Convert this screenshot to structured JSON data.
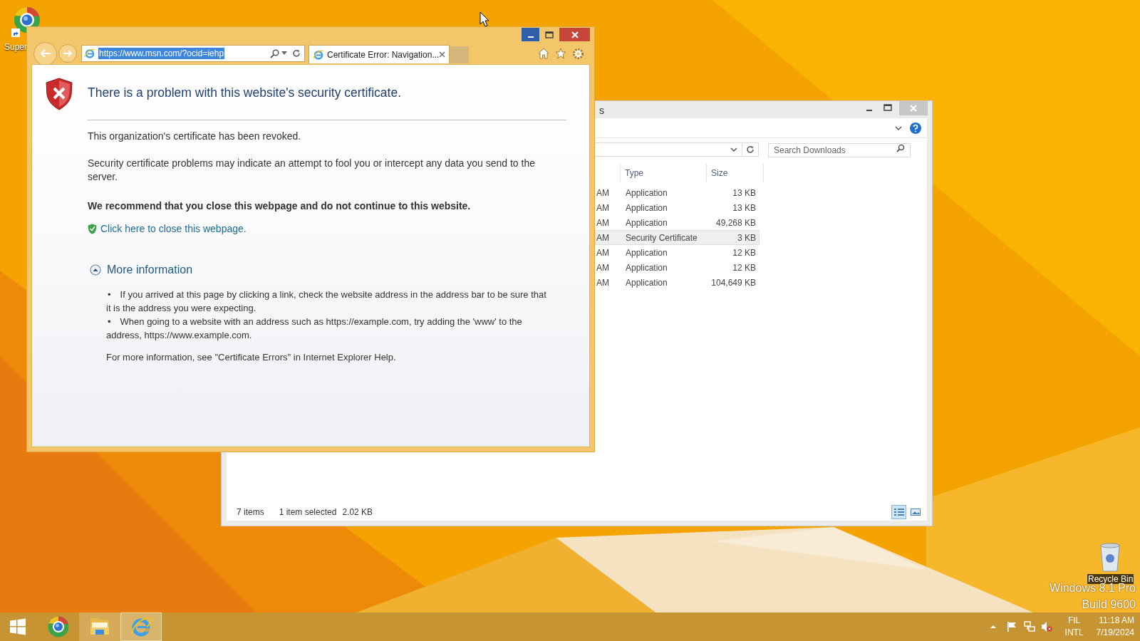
{
  "desktop": {
    "icons": [
      {
        "kind": "app",
        "label": "Super"
      },
      {
        "kind": "recycle",
        "label": "Recycle Bin"
      }
    ],
    "watermark": [
      "Windows 8.1 Pro",
      "Build 9600"
    ]
  },
  "ie_window": {
    "address": {
      "value": "https://www.msn.com/?ocid=iehp",
      "selected": true
    },
    "tabs": [
      {
        "label": "Certificate Error: Navigation...",
        "selected": true
      }
    ],
    "page": {
      "heading": "There is a problem with this website's security certificate.",
      "paragraphs": [
        "This organization's certificate has been revoked.",
        "Security certificate problems may indicate an attempt to fool you or intercept any data you send to the server."
      ],
      "recommendation": "We recommend that you close this webpage and do not continue to this website.",
      "close_link": "Click here to close this webpage.",
      "more_info": {
        "label": "More information",
        "expanded": true,
        "bullets": [
          {
            "marker": "•",
            "text": "If you arrived at this page by clicking a link, check the website address in the address bar to be sure that it is the address you were expecting."
          },
          {
            "marker": "•",
            "text": "When going to a website with an address such as https://example.com, try adding the 'www' to the address, https://www.example.com."
          }
        ],
        "footer": "For more information, see \"Certificate Errors\" in Internet Explorer Help."
      }
    }
  },
  "explorer_window": {
    "title": "s",
    "search": {
      "placeholder": "Search Downloads"
    },
    "columns": [
      "Type",
      "Size"
    ],
    "rows": [
      {
        "time": "AM",
        "type": "Application",
        "size": "13 KB",
        "selected": false
      },
      {
        "time": "AM",
        "type": "Application",
        "size": "13 KB",
        "selected": false
      },
      {
        "time": "AM",
        "type": "Application",
        "size": "49,268 KB",
        "selected": false
      },
      {
        "time": "AM",
        "type": "Security Certificate",
        "size": "3 KB",
        "selected": true
      },
      {
        "time": "AM",
        "type": "Application",
        "size": "12 KB",
        "selected": false
      },
      {
        "time": "AM",
        "type": "Application",
        "size": "12 KB",
        "selected": false
      },
      {
        "time": "AM",
        "type": "Application",
        "size": "104,649 KB",
        "selected": false
      }
    ],
    "status": {
      "count": "7 items",
      "selection": "1 item selected",
      "selection_size": "2.02 KB"
    },
    "views": [
      {
        "kind": "details",
        "selected": true
      },
      {
        "kind": "large",
        "selected": false
      }
    ]
  },
  "taskbar": {
    "apps": [
      {
        "kind": "app",
        "running": false,
        "selected": false
      },
      {
        "kind": "folder",
        "running": true,
        "selected": false
      },
      {
        "kind": "browser",
        "running": true,
        "selected": true
      }
    ],
    "tray": {
      "language": "FIL",
      "layout": "INTL",
      "time": "11:18 AM",
      "date": "7/19/2024"
    }
  }
}
